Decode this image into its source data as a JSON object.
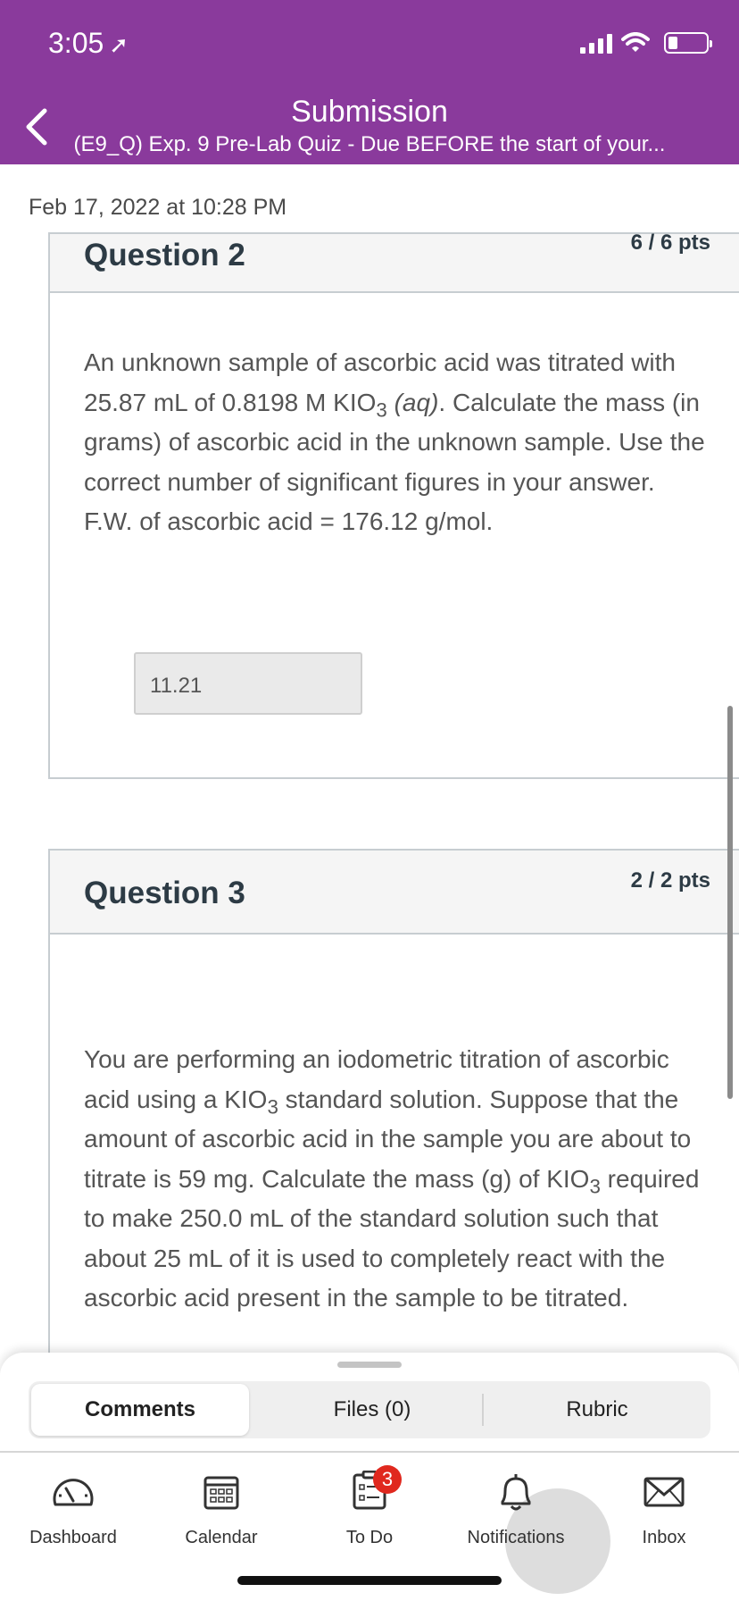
{
  "status": {
    "time": "3:05",
    "location_icon": "location-arrow-icon"
  },
  "header": {
    "title": "Submission",
    "subtitle": "(E9_Q) Exp. 9 Pre-Lab Quiz - Due BEFORE the start of your..."
  },
  "submission_date": "Feb 17, 2022 at 10:28 PM",
  "questions": [
    {
      "title": "Question 2",
      "points": "6 / 6 pts",
      "text_parts": [
        "An unknown sample of ascorbic acid was titrated with 25.87 mL of 0.8198 M KIO",
        "3",
        " ",
        "(aq)",
        ". Calculate the mass (in grams) of ascorbic acid in the unknown sample. Use the correct number of significant figures in your answer.  F.W. of ascorbic acid = 176.12 g/mol."
      ],
      "answer": "11.21"
    },
    {
      "title": "Question 3",
      "points": "2 / 2 pts",
      "text_parts": [
        "You are performing an iodometric titration of ascorbic acid using a KIO",
        "3",
        " standard solution. Suppose that the amount of ascorbic acid in the sample you are about to titrate is 59 mg. Calculate the mass (g) of KIO",
        "3",
        " required to make 250.0 mL of the standard solution such that about 25 mL of it is used to completely react with the ascorbic acid present in the sample to be titrated."
      ]
    }
  ],
  "segments": [
    {
      "label": "Comments",
      "active": true
    },
    {
      "label": "Files (0)",
      "active": false
    },
    {
      "label": "Rubric",
      "active": false
    }
  ],
  "tabs": [
    {
      "label": "Dashboard",
      "icon": "speedometer-icon"
    },
    {
      "label": "Calendar",
      "icon": "calendar-icon"
    },
    {
      "label": "To Do",
      "icon": "todo-list-icon",
      "badge": "3"
    },
    {
      "label": "Notifications",
      "icon": "bell-icon"
    },
    {
      "label": "Inbox",
      "icon": "envelope-icon"
    }
  ],
  "colors": {
    "header": "#8a3a9c",
    "badge": "#e0281e"
  }
}
